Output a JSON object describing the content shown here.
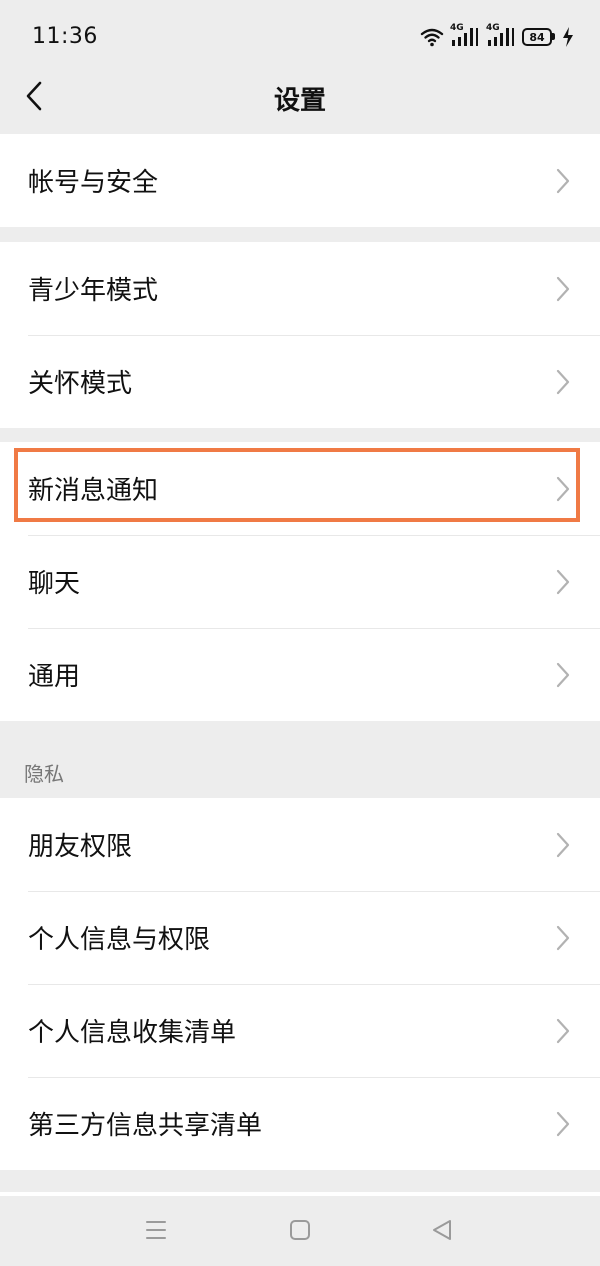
{
  "status_bar": {
    "time": "11:36",
    "signal_1_label": "4G",
    "signal_2_label": "4G",
    "battery": "84",
    "icons": [
      "wifi-icon",
      "signal-4g-icon",
      "signal-4g-icon",
      "battery-icon",
      "charging-icon"
    ]
  },
  "header": {
    "title": "设置",
    "back_icon": "chevron-left-icon"
  },
  "groups": [
    {
      "items": [
        {
          "label": "帐号与安全"
        }
      ]
    },
    {
      "items": [
        {
          "label": "青少年模式"
        },
        {
          "label": "关怀模式"
        }
      ]
    },
    {
      "items": [
        {
          "label": "新消息通知",
          "highlighted": true
        },
        {
          "label": "聊天"
        },
        {
          "label": "通用"
        }
      ]
    },
    {
      "header": "隐私",
      "items": [
        {
          "label": "朋友权限"
        },
        {
          "label": "个人信息与权限"
        },
        {
          "label": "个人信息收集清单"
        },
        {
          "label": "第三方信息共享清单"
        }
      ]
    }
  ],
  "nav_bar": {
    "buttons": [
      "menu-icon",
      "home-square-icon",
      "back-triangle-icon"
    ]
  },
  "colors": {
    "background": "#ededed",
    "card": "#ffffff",
    "highlight": "#f07a45",
    "chevron": "#b2b2b2"
  }
}
